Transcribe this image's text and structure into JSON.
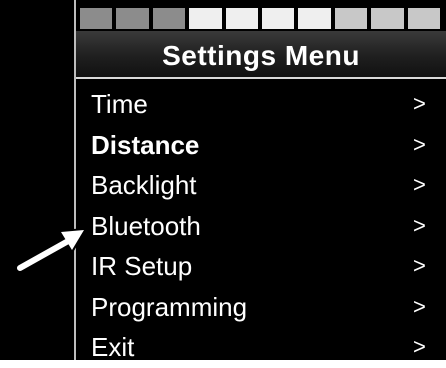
{
  "segment_colors": [
    "#8c8c8c",
    "#8c8c8c",
    "#8c8c8c",
    "#efefef",
    "#efefef",
    "#efefef",
    "#efefef",
    "#c8c8c8",
    "#c8c8c8",
    "#c8c8c8"
  ],
  "header": {
    "title": "Settings Menu"
  },
  "menu": {
    "chevron": ">",
    "items": [
      {
        "label": "Time"
      },
      {
        "label": "Distance"
      },
      {
        "label": "Backlight"
      },
      {
        "label": "Bluetooth"
      },
      {
        "label": "IR Setup"
      },
      {
        "label": "Programming"
      },
      {
        "label": "Exit"
      }
    ]
  },
  "pointer": {
    "icon": "arrow-icon",
    "target": "Bluetooth"
  },
  "colors": {
    "background": "#000000",
    "text": "#ffffff",
    "arrow": "#ffffff"
  }
}
